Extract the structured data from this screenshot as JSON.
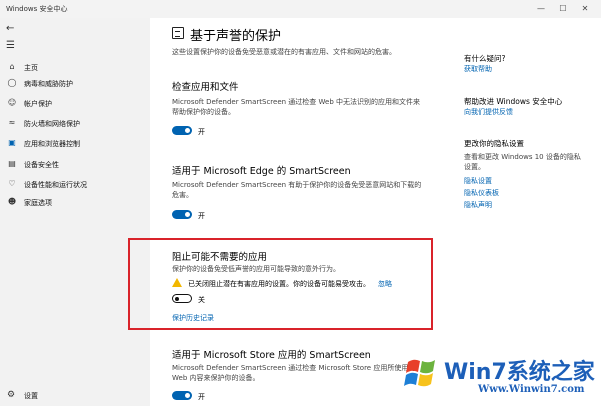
{
  "window": {
    "title": "Windows 安全中心"
  },
  "sidebar": {
    "items": [
      {
        "label": "主页",
        "icon": "home-icon"
      },
      {
        "label": "病毒和威胁防护",
        "icon": "shield-icon"
      },
      {
        "label": "帐户保护",
        "icon": "person-icon"
      },
      {
        "label": "防火墙和网络保护",
        "icon": "wifi-icon"
      },
      {
        "label": "应用和浏览器控制",
        "icon": "app-browser-icon"
      },
      {
        "label": "设备安全性",
        "icon": "laptop-icon"
      },
      {
        "label": "设备性能和运行状况",
        "icon": "heart-icon"
      },
      {
        "label": "家庭选项",
        "icon": "family-icon"
      }
    ],
    "settings_label": "设置"
  },
  "main": {
    "title": "基于声誉的保护",
    "description": "这些设置保护你的设备免受恶意或潜在的有害应用、文件和网站的危害。",
    "sections": [
      {
        "title": "检查应用和文件",
        "description": "Microsoft Defender SmartScreen 通过检查 Web 中无法识别的应用和文件来帮助保护你的设备。",
        "toggle_label": "开"
      },
      {
        "title": "适用于 Microsoft Edge 的 SmartScreen",
        "description": "Microsoft Defender SmartScreen 有助于保护你的设备免受恶意网站和下载的危害。",
        "toggle_label": "开"
      },
      {
        "title": "阻止可能不需要的应用",
        "description": "保护你的设备免受低声誉的应用可能导致的意外行为。",
        "warning": "已关闭阻止潜在有害应用的设置。你的设备可能易受攻击。",
        "ignore_label": "忽略",
        "toggle_label": "关",
        "history_link": "保护历史记录"
      },
      {
        "title": "适用于 Microsoft Store 应用的 SmartScreen",
        "description": "Microsoft Defender SmartScreen 通过检查 Microsoft Store 应用所使用的 Web 内容来保护你的设备。",
        "toggle_label": "开"
      }
    ]
  },
  "right": {
    "question": "有什么疑问?",
    "get_help": "获取帮助",
    "improve_head": "帮助改进 Windows 安全中心",
    "feedback": "向我们提供反馈",
    "privacy_head": "更改你的隐私设置",
    "privacy_desc": "查看和更改 Windows 10 设备的隐私设置。",
    "privacy_settings": "隐私设置",
    "privacy_dashboard": "隐私仪表板",
    "privacy_statement": "隐私声明"
  },
  "watermark": {
    "line1": "Win7系统之家",
    "line2": "Www.Winwin7.com"
  },
  "colors": {
    "accent": "#0063b1",
    "highlight": "#d9232a",
    "warning": "#f2b700"
  }
}
